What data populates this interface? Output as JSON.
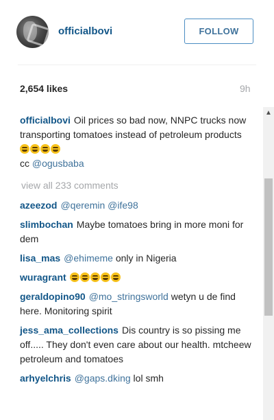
{
  "post": {
    "username": "officialbovi",
    "follow_label": "FOLLOW",
    "likes": "2,654 likes",
    "time": "9h"
  },
  "caption": {
    "username": "officialbovi",
    "text": "Oil prices so bad now, NNPC trucks now transporting tomatoes instead of petroleum products",
    "emoji_count": 4,
    "cc_prefix": "cc",
    "mention": "@ogusbaba"
  },
  "view_all_label": "view all 233 comments",
  "comments": [
    {
      "username": "azeezod",
      "mention1": "@qeremin",
      "mention2": "@ife98"
    },
    {
      "username": "slimbochan",
      "text": "Maybe tomatoes bring in more moni for dem"
    },
    {
      "username": "lisa_mas",
      "mention": "@ehimeme",
      "text": "only in Nigeria"
    },
    {
      "username": "wuragrant",
      "emoji_count": 5
    },
    {
      "username": "geraldopino90",
      "mention": "@mo_stringsworld",
      "text": "wetyn u de find here. Monitoring spirit"
    },
    {
      "username": "jess_ama_collections",
      "text": "Dis country is so pissing me off..... They don't even care about our health. mtcheew petroleum and tomatoes"
    },
    {
      "username": "arhyelchris",
      "mention": "@gaps.dking",
      "text": "lol smh"
    }
  ],
  "icons": {
    "emoji": "laughing-tears-emoji-icon",
    "scroll_up": "scroll-up-arrow-icon"
  },
  "colors": {
    "username": "#125688",
    "follow_border": "#4a8cc2",
    "muted": "#a5a7aa",
    "emoji": "#f7c21c"
  }
}
